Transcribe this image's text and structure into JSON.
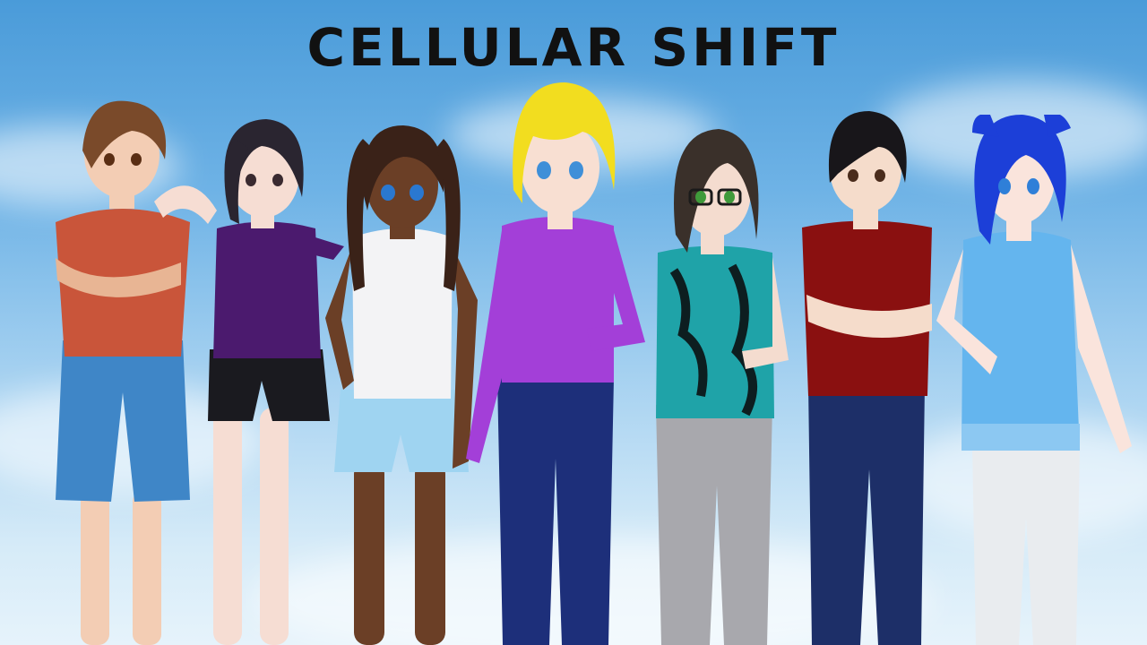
{
  "game": {
    "title": "CELLULAR SHIFT"
  },
  "characters": [
    {
      "id": "boy-brown-hair",
      "hair": "#7a4a2a",
      "skin": "#f3cdb4",
      "top": "#c9553a",
      "bottom": "#3f86c7"
    },
    {
      "id": "girl-ponytail-purple",
      "hair": "#2a2530",
      "skin": "#f6ddd3",
      "top": "#4b1a6e",
      "bottom": "#1a1a1f"
    },
    {
      "id": "girl-dark-skin-twintails",
      "hair": "#3a2218",
      "skin": "#6b3f26",
      "top": "#f3f3f5",
      "bottom": "#9fd4f1"
    },
    {
      "id": "girl-blonde",
      "hair": "#f2dd1f",
      "skin": "#f8dfd2",
      "top": "#a33fd8",
      "bottom": "#1d2f7a"
    },
    {
      "id": "girl-glasses-dragon-shirt",
      "hair": "#3a302a",
      "skin": "#f4dccf",
      "top": "#1fa3a8",
      "bottom": "#a8a8ad"
    },
    {
      "id": "boy-black-hair",
      "hair": "#18161a",
      "skin": "#f5dccb",
      "top": "#8a1010",
      "bottom": "#1d2f68"
    },
    {
      "id": "girl-blue-hair",
      "hair": "#1c3fd8",
      "skin": "#fae4dc",
      "top": "#64b5ee",
      "bottom": "#e9ecef"
    }
  ]
}
